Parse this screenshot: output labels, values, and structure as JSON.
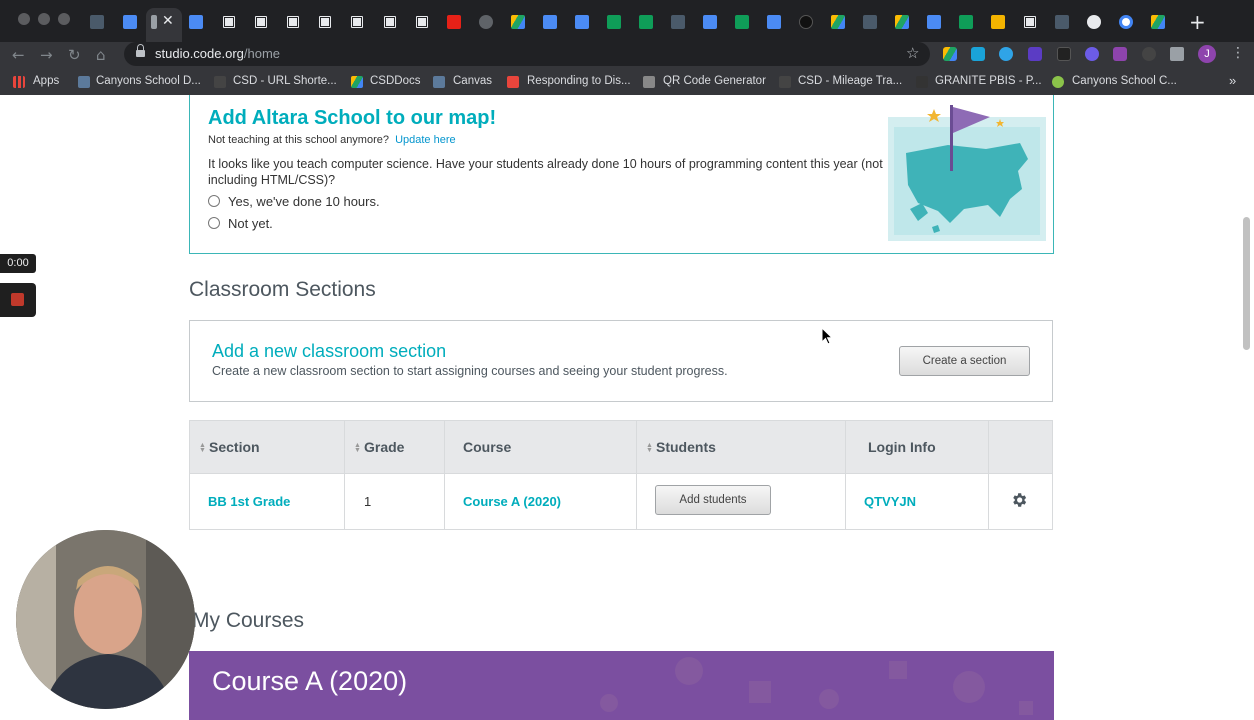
{
  "browser": {
    "url_host": "studio.code.org",
    "url_path": "/home",
    "tab_close_glyph": "✕",
    "new_tab_glyph": "+",
    "bookmarks": [
      {
        "label": "Apps",
        "icon": "apps-grid-icon",
        "color": "#e8453c"
      },
      {
        "label": "Canyons School D...",
        "icon": "canyons-icon",
        "color": "#5c7a9b"
      },
      {
        "label": "CSD - URL Shorte...",
        "icon": "url-shortener-icon",
        "color": "#444444"
      },
      {
        "label": "CSDDocs",
        "icon": "drive-icon",
        "color": "#1fa463"
      },
      {
        "label": "Canvas",
        "icon": "canvas-icon",
        "color": "#5c7a9b"
      },
      {
        "label": "Responding to Dis...",
        "icon": "responding-icon",
        "color": "#e8453c"
      },
      {
        "label": "QR Code Generator",
        "icon": "qr-code-icon",
        "color": "#888888"
      },
      {
        "label": "CSD - Mileage Tra...",
        "icon": "mileage-icon",
        "color": "#444444"
      },
      {
        "label": "GRANITE PBIS - P...",
        "icon": "granite-icon",
        "color": "#333333"
      },
      {
        "label": "Canyons School C...",
        "icon": "canyons-c-icon",
        "color": "#8bc34a"
      }
    ],
    "bookmarks_more": "»"
  },
  "map_card": {
    "title": "Add Altara School to our map!",
    "not_teaching": "Not teaching at this school anymore?",
    "update_link": "Update here",
    "question": "It looks like you teach computer science. Have your students already done 10 hours of programming content this year (not including HTML/CSS)?",
    "option_yes": "Yes, we've done 10 hours.",
    "option_no": "Not yet."
  },
  "classroom": {
    "heading": "Classroom Sections",
    "add_title": "Add a new classroom section",
    "add_desc": "Create a new classroom section to start assigning courses and seeing your student progress.",
    "create_button": "Create a section",
    "columns": [
      "Section",
      "Grade",
      "Course",
      "Students",
      "Login Info"
    ],
    "rows": [
      {
        "section": "BB 1st Grade",
        "grade": "1",
        "course": "Course A (2020)",
        "students_button": "Add students",
        "login": "QTVYJN"
      }
    ]
  },
  "courses": {
    "heading": "My Courses",
    "banner_title": "Course A (2020)"
  },
  "recorder": {
    "timer": "0:00"
  },
  "colors": {
    "teal": "#00adbc",
    "purple": "#7b4fa0",
    "chrome_dark": "#202124"
  }
}
